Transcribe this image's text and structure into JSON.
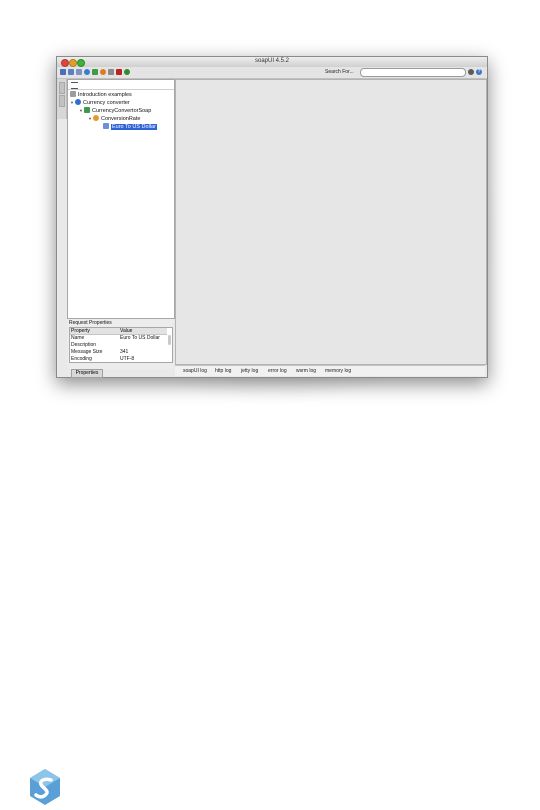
{
  "window": {
    "title": "soapUI 4.5.2"
  },
  "toolbar": {
    "icons": [
      "new-project-icon",
      "import-project-icon",
      "save-all-icon",
      "help-icon",
      "preferences-icon",
      "proxy-icon",
      "tools-icon",
      "exit-icon",
      "about-icon"
    ],
    "search_label": "Search For...",
    "search_value": ""
  },
  "navigator": {
    "tree": [
      {
        "label": "Introduction examples",
        "level": 0,
        "icon": "workspace-icon"
      },
      {
        "label": "Currency converter",
        "level": 1,
        "icon": "project-icon"
      },
      {
        "label": "CurrencyConvertorSoap",
        "level": 2,
        "icon": "interface-icon"
      },
      {
        "label": "ConversionRate",
        "level": 3,
        "icon": "operation-icon"
      },
      {
        "label": "Euro To US Dollar",
        "level": 4,
        "icon": "request-icon",
        "selected": true
      }
    ]
  },
  "properties": {
    "title": "Request Properties",
    "columns": [
      "Property",
      "Value"
    ],
    "rows": [
      [
        "Name",
        "Euro To US Dollar"
      ],
      [
        "Description",
        ""
      ],
      [
        "Message Size",
        "341"
      ],
      [
        "Encoding",
        "UTF-8"
      ]
    ],
    "button_label": "Properties"
  },
  "logs": {
    "tabs": [
      "soapUI log",
      "http log",
      "jetty log",
      "error log",
      "wsrm log",
      "memory log"
    ]
  },
  "colors": {
    "selection": "#2f63d6",
    "workspace_bg": "#e6e6e6"
  }
}
